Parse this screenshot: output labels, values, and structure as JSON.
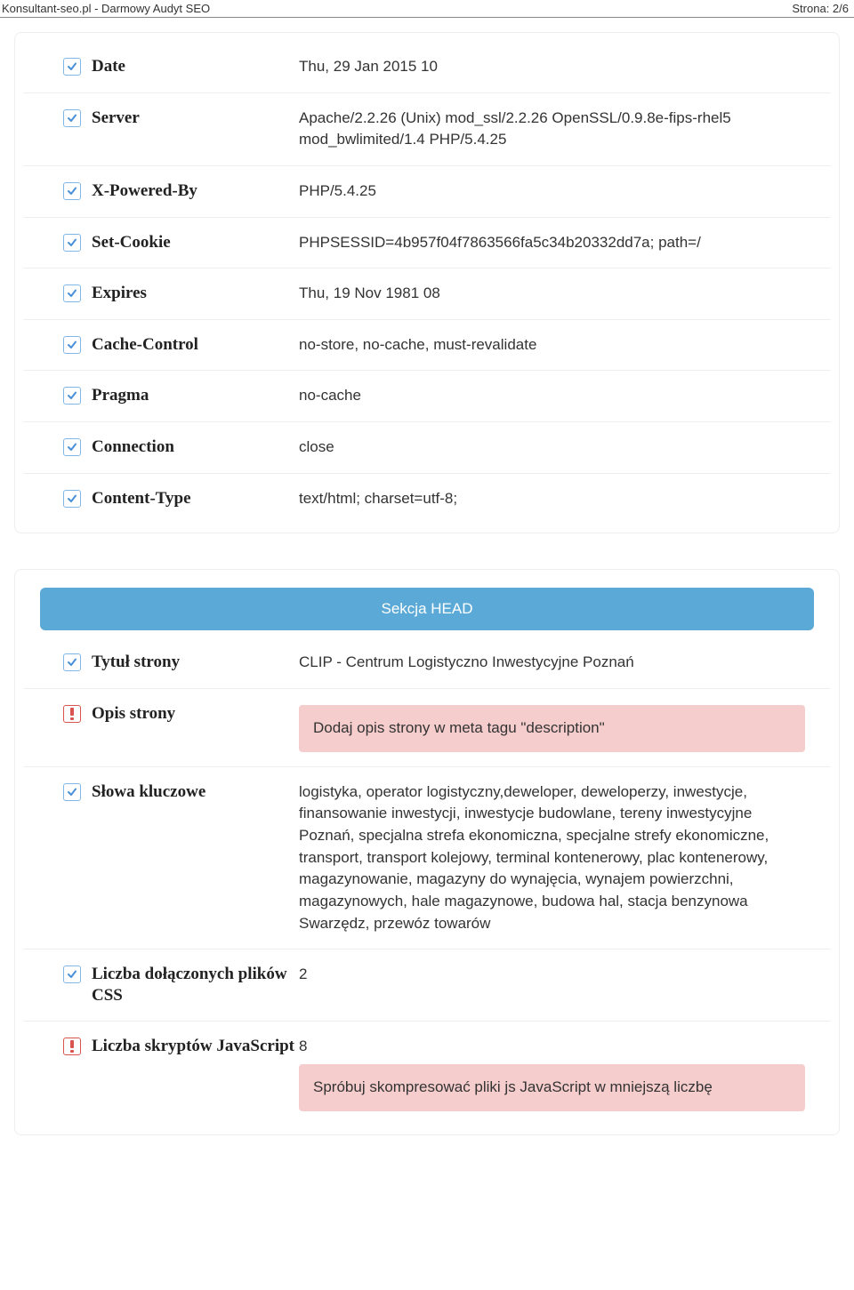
{
  "header": {
    "left": "Konsultant-seo.pl - Darmowy Audyt SEO",
    "right": "Strona: 2/6"
  },
  "section1": {
    "rows": [
      {
        "status": "ok",
        "label": "Date",
        "value": "Thu, 29 Jan 2015 10"
      },
      {
        "status": "ok",
        "label": "Server",
        "value": "Apache/2.2.26 (Unix) mod_ssl/2.2.26 OpenSSL/0.9.8e-fips-rhel5 mod_bwlimited/1.4 PHP/5.4.25"
      },
      {
        "status": "ok",
        "label": "X-Powered-By",
        "value": "PHP/5.4.25"
      },
      {
        "status": "ok",
        "label": "Set-Cookie",
        "value": "PHPSESSID=4b957f04f7863566fa5c34b20332dd7a; path=/"
      },
      {
        "status": "ok",
        "label": "Expires",
        "value": "Thu, 19 Nov 1981 08"
      },
      {
        "status": "ok",
        "label": "Cache-Control",
        "value": "no-store, no-cache, must-revalidate"
      },
      {
        "status": "ok",
        "label": "Pragma",
        "value": "no-cache"
      },
      {
        "status": "ok",
        "label": "Connection",
        "value": "close"
      },
      {
        "status": "ok",
        "label": "Content-Type",
        "value": "text/html; charset=utf-8;"
      }
    ]
  },
  "section2": {
    "title": "Sekcja HEAD",
    "rows": [
      {
        "status": "ok",
        "label": "Tytuł strony",
        "value": "CLIP - Centrum Logistyczno Inwestycyjne Poznań"
      },
      {
        "status": "err",
        "label": "Opis strony",
        "warn": "Dodaj opis strony w meta tagu \"description\""
      },
      {
        "status": "ok",
        "label": "Słowa kluczowe",
        "value": "logistyka, operator logistyczny,deweloper, deweloperzy, inwestycje, finansowanie inwestycji, inwestycje budowlane, tereny inwestycyjne Poznań, specjalna strefa ekonomiczna, specjalne strefy ekonomiczne, transport, transport kolejowy, terminal kontenerowy, plac kontenerowy, magazynowanie, magazyny do wynajęcia, wynajem powierzchni, magazynowych, hale magazynowe, budowa hal, stacja benzynowa Swarzędz, przewóz towarów"
      },
      {
        "status": "ok",
        "label": "Liczba dołączonych plików CSS",
        "value": "2"
      },
      {
        "status": "err",
        "label": "Liczba skryptów JavaScript",
        "value": "8",
        "warn": "Spróbuj skompresować pliki js JavaScript w mniejszą liczbę"
      }
    ]
  }
}
